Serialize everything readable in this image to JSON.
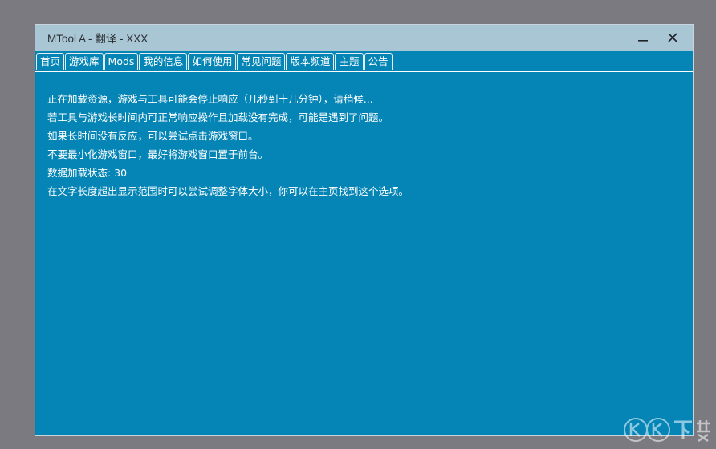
{
  "window": {
    "title": "MTool A - 翻译 - XXX"
  },
  "tabs": [
    "首页",
    "游戏库",
    "Mods",
    "我的信息",
    "如何使用",
    "常见问题",
    "版本频道",
    "主题",
    "公告"
  ],
  "content": {
    "lines": [
      "正在加载资源，游戏与工具可能会停止响应（几秒到十几分钟），请稍候...",
      "若工具与游戏长时间内可正常响应操作且加载没有完成，可能是遇到了问题。",
      "如果长时间没有反应，可以尝试点击游戏窗口。",
      "不要最小化游戏窗口，最好将游戏窗口置于前台。",
      "数据加载状态: 30",
      "在文字长度超出显示范围时可以尝试调整字体大小，你可以在主页找到这个选项。"
    ]
  },
  "watermark": {
    "text": "KK下载"
  }
}
